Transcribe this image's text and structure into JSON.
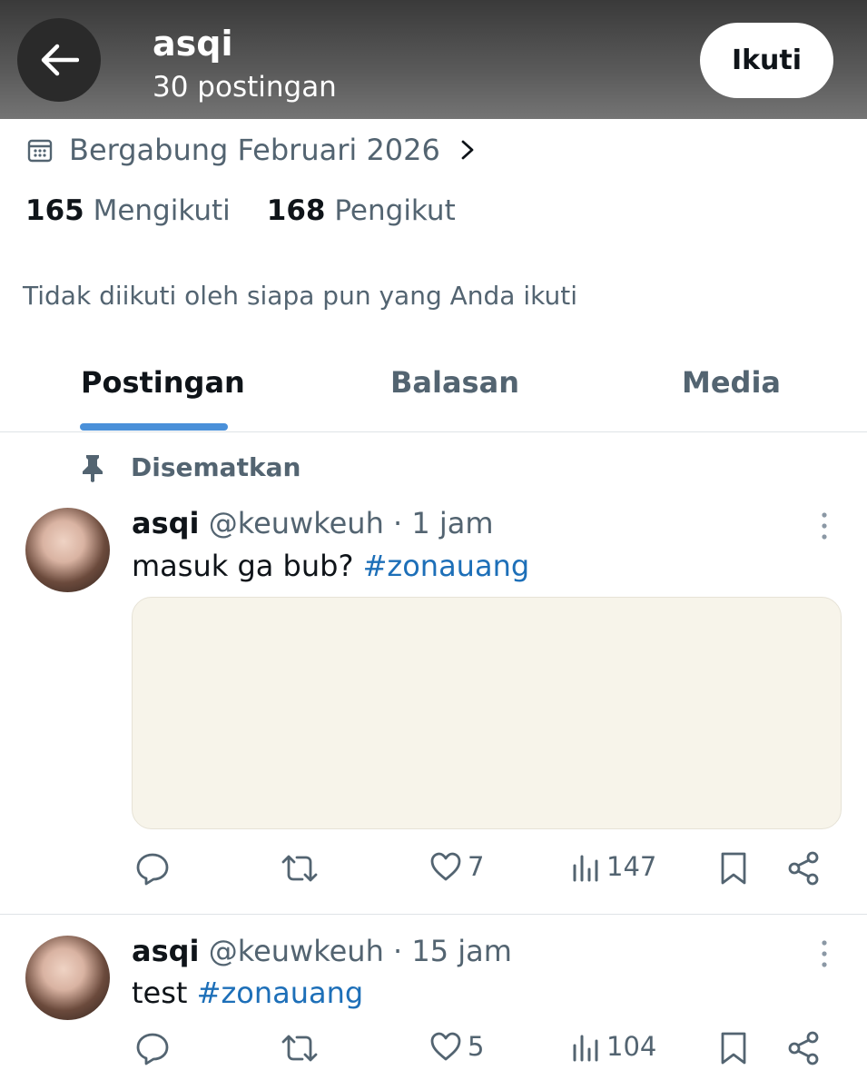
{
  "header": {
    "title": "asqi",
    "subtitle": "30 postingan",
    "follow_label": "Ikuti"
  },
  "profile": {
    "joined": "Bergabung Februari 2026",
    "following_count": "165",
    "following_label": "Mengikuti",
    "followers_count": "168",
    "followers_label": "Pengikut",
    "followed_by_note": "Tidak diikuti oleh siapa pun yang Anda ikuti"
  },
  "tabs": [
    {
      "label": "Postingan",
      "active": true
    },
    {
      "label": "Balasan",
      "active": false
    },
    {
      "label": "Media",
      "active": false
    }
  ],
  "pinned_label": "Disematkan",
  "posts": [
    {
      "name": "asqi",
      "handle_time": "@keuwkeuh · 1 jam",
      "text": "masuk ga bub?",
      "hashtag": "#zonauang",
      "likes": "7",
      "views": "147"
    },
    {
      "name": "asqi",
      "handle_time": "@keuwkeuh · 15 jam",
      "text": "test",
      "hashtag": "#zonauang",
      "likes": "5",
      "views": "104"
    }
  ],
  "icons": {
    "back": "arrow-left-icon",
    "calendar": "calendar-icon",
    "chevron": "chevron-right-icon",
    "pin": "pin-icon",
    "more": "more-vertical-icon",
    "reply": "reply-icon",
    "retweet": "retweet-icon",
    "like": "heart-icon",
    "views": "views-icon",
    "bookmark": "bookmark-icon",
    "share": "share-icon"
  },
  "colors": {
    "accent": "#4a90d9",
    "hashtag": "#1d6fb8",
    "secondary_text": "#536471"
  }
}
